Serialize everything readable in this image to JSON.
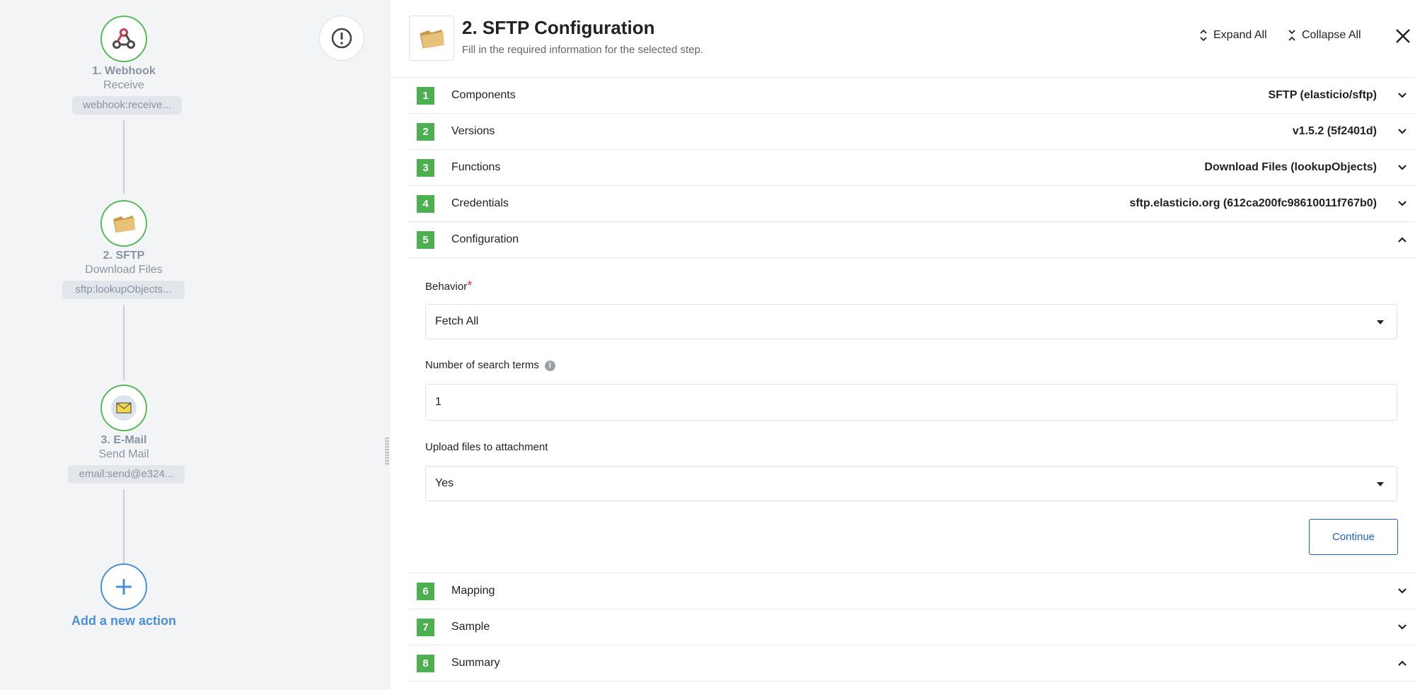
{
  "flow": {
    "nodes": [
      {
        "title": "1. Webhook",
        "subtitle": "Receive",
        "chip": "webhook:receive..."
      },
      {
        "title": "2. SFTP",
        "subtitle": "Download Files",
        "chip": "sftp:lookupObjects..."
      },
      {
        "title": "3. E-Mail",
        "subtitle": "Send Mail",
        "chip": "email:send@e324..."
      }
    ],
    "add_action_label": "Add a new action"
  },
  "header": {
    "title": "2. SFTP Configuration",
    "subtitle": "Fill in the required information for the selected step.",
    "expand_all": "Expand All",
    "collapse_all": "Collapse All"
  },
  "steps": [
    {
      "num": "1",
      "label": "Components",
      "value": "SFTP (elasticio/sftp)"
    },
    {
      "num": "2",
      "label": "Versions",
      "value": "v1.5.2 (5f2401d)"
    },
    {
      "num": "3",
      "label": "Functions",
      "value": "Download Files (lookupObjects)"
    },
    {
      "num": "4",
      "label": "Credentials",
      "value": "sftp.elasticio.org (612ca200fc98610011f767b0)"
    },
    {
      "num": "5",
      "label": "Configuration",
      "value": ""
    },
    {
      "num": "6",
      "label": "Mapping",
      "value": ""
    },
    {
      "num": "7",
      "label": "Sample",
      "value": ""
    },
    {
      "num": "8",
      "label": "Summary",
      "value": ""
    }
  ],
  "config": {
    "behavior_label": "Behavior",
    "behavior_required_mark": "*",
    "behavior_value": "Fetch All",
    "search_terms_label": "Number of search terms",
    "search_terms_value": "1",
    "upload_label": "Upload files to attachment",
    "upload_value": "Yes",
    "continue_label": "Continue"
  },
  "colors": {
    "step_badge": "#4caf50",
    "accent_blue": "#1e64c8",
    "node_border": "#5cb85c"
  }
}
